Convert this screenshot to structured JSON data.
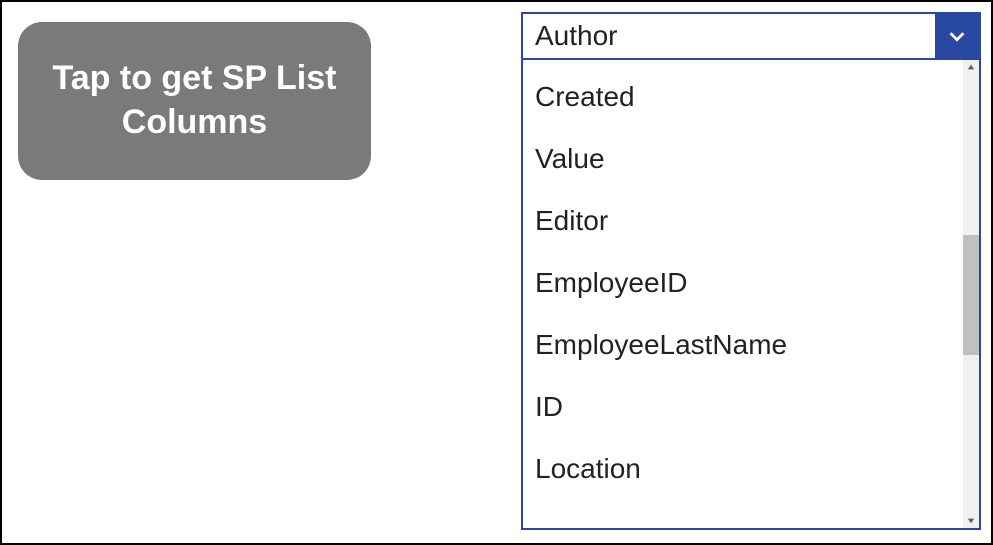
{
  "button": {
    "label": "Tap to get SP List Columns"
  },
  "dropdown": {
    "selected": "Author",
    "options": [
      "Created",
      "Value",
      "Editor",
      "EmployeeID",
      "EmployeeLastName",
      "ID",
      "Location"
    ]
  }
}
